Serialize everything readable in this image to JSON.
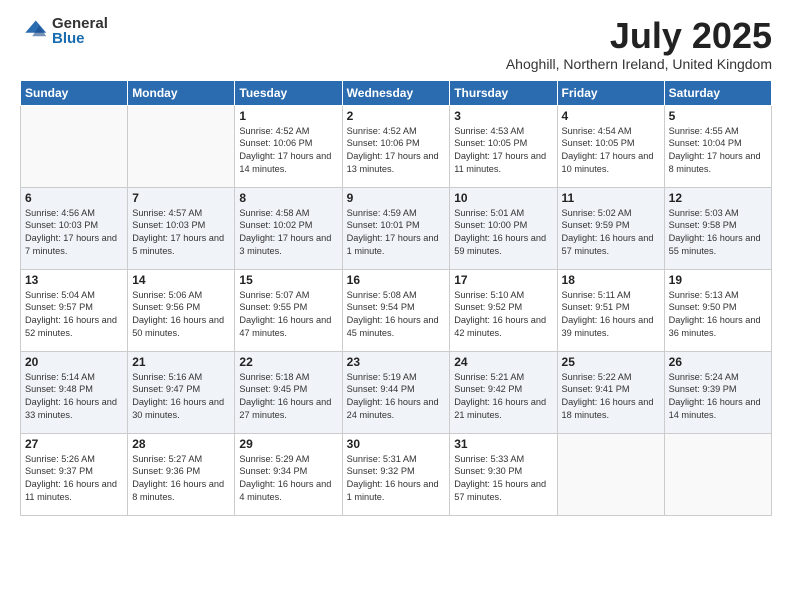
{
  "logo": {
    "general": "General",
    "blue": "Blue"
  },
  "title": {
    "month": "July 2025",
    "location": "Ahoghill, Northern Ireland, United Kingdom"
  },
  "weekdays": [
    "Sunday",
    "Monday",
    "Tuesday",
    "Wednesday",
    "Thursday",
    "Friday",
    "Saturday"
  ],
  "weeks": [
    [
      {
        "day": "",
        "sunrise": "",
        "sunset": "",
        "daylight": "",
        "empty": true
      },
      {
        "day": "",
        "sunrise": "",
        "sunset": "",
        "daylight": "",
        "empty": true
      },
      {
        "day": "1",
        "sunrise": "Sunrise: 4:52 AM",
        "sunset": "Sunset: 10:06 PM",
        "daylight": "Daylight: 17 hours and 14 minutes.",
        "empty": false
      },
      {
        "day": "2",
        "sunrise": "Sunrise: 4:52 AM",
        "sunset": "Sunset: 10:06 PM",
        "daylight": "Daylight: 17 hours and 13 minutes.",
        "empty": false
      },
      {
        "day": "3",
        "sunrise": "Sunrise: 4:53 AM",
        "sunset": "Sunset: 10:05 PM",
        "daylight": "Daylight: 17 hours and 11 minutes.",
        "empty": false
      },
      {
        "day": "4",
        "sunrise": "Sunrise: 4:54 AM",
        "sunset": "Sunset: 10:05 PM",
        "daylight": "Daylight: 17 hours and 10 minutes.",
        "empty": false
      },
      {
        "day": "5",
        "sunrise": "Sunrise: 4:55 AM",
        "sunset": "Sunset: 10:04 PM",
        "daylight": "Daylight: 17 hours and 8 minutes.",
        "empty": false
      }
    ],
    [
      {
        "day": "6",
        "sunrise": "Sunrise: 4:56 AM",
        "sunset": "Sunset: 10:03 PM",
        "daylight": "Daylight: 17 hours and 7 minutes.",
        "empty": false
      },
      {
        "day": "7",
        "sunrise": "Sunrise: 4:57 AM",
        "sunset": "Sunset: 10:03 PM",
        "daylight": "Daylight: 17 hours and 5 minutes.",
        "empty": false
      },
      {
        "day": "8",
        "sunrise": "Sunrise: 4:58 AM",
        "sunset": "Sunset: 10:02 PM",
        "daylight": "Daylight: 17 hours and 3 minutes.",
        "empty": false
      },
      {
        "day": "9",
        "sunrise": "Sunrise: 4:59 AM",
        "sunset": "Sunset: 10:01 PM",
        "daylight": "Daylight: 17 hours and 1 minute.",
        "empty": false
      },
      {
        "day": "10",
        "sunrise": "Sunrise: 5:01 AM",
        "sunset": "Sunset: 10:00 PM",
        "daylight": "Daylight: 16 hours and 59 minutes.",
        "empty": false
      },
      {
        "day": "11",
        "sunrise": "Sunrise: 5:02 AM",
        "sunset": "Sunset: 9:59 PM",
        "daylight": "Daylight: 16 hours and 57 minutes.",
        "empty": false
      },
      {
        "day": "12",
        "sunrise": "Sunrise: 5:03 AM",
        "sunset": "Sunset: 9:58 PM",
        "daylight": "Daylight: 16 hours and 55 minutes.",
        "empty": false
      }
    ],
    [
      {
        "day": "13",
        "sunrise": "Sunrise: 5:04 AM",
        "sunset": "Sunset: 9:57 PM",
        "daylight": "Daylight: 16 hours and 52 minutes.",
        "empty": false
      },
      {
        "day": "14",
        "sunrise": "Sunrise: 5:06 AM",
        "sunset": "Sunset: 9:56 PM",
        "daylight": "Daylight: 16 hours and 50 minutes.",
        "empty": false
      },
      {
        "day": "15",
        "sunrise": "Sunrise: 5:07 AM",
        "sunset": "Sunset: 9:55 PM",
        "daylight": "Daylight: 16 hours and 47 minutes.",
        "empty": false
      },
      {
        "day": "16",
        "sunrise": "Sunrise: 5:08 AM",
        "sunset": "Sunset: 9:54 PM",
        "daylight": "Daylight: 16 hours and 45 minutes.",
        "empty": false
      },
      {
        "day": "17",
        "sunrise": "Sunrise: 5:10 AM",
        "sunset": "Sunset: 9:52 PM",
        "daylight": "Daylight: 16 hours and 42 minutes.",
        "empty": false
      },
      {
        "day": "18",
        "sunrise": "Sunrise: 5:11 AM",
        "sunset": "Sunset: 9:51 PM",
        "daylight": "Daylight: 16 hours and 39 minutes.",
        "empty": false
      },
      {
        "day": "19",
        "sunrise": "Sunrise: 5:13 AM",
        "sunset": "Sunset: 9:50 PM",
        "daylight": "Daylight: 16 hours and 36 minutes.",
        "empty": false
      }
    ],
    [
      {
        "day": "20",
        "sunrise": "Sunrise: 5:14 AM",
        "sunset": "Sunset: 9:48 PM",
        "daylight": "Daylight: 16 hours and 33 minutes.",
        "empty": false
      },
      {
        "day": "21",
        "sunrise": "Sunrise: 5:16 AM",
        "sunset": "Sunset: 9:47 PM",
        "daylight": "Daylight: 16 hours and 30 minutes.",
        "empty": false
      },
      {
        "day": "22",
        "sunrise": "Sunrise: 5:18 AM",
        "sunset": "Sunset: 9:45 PM",
        "daylight": "Daylight: 16 hours and 27 minutes.",
        "empty": false
      },
      {
        "day": "23",
        "sunrise": "Sunrise: 5:19 AM",
        "sunset": "Sunset: 9:44 PM",
        "daylight": "Daylight: 16 hours and 24 minutes.",
        "empty": false
      },
      {
        "day": "24",
        "sunrise": "Sunrise: 5:21 AM",
        "sunset": "Sunset: 9:42 PM",
        "daylight": "Daylight: 16 hours and 21 minutes.",
        "empty": false
      },
      {
        "day": "25",
        "sunrise": "Sunrise: 5:22 AM",
        "sunset": "Sunset: 9:41 PM",
        "daylight": "Daylight: 16 hours and 18 minutes.",
        "empty": false
      },
      {
        "day": "26",
        "sunrise": "Sunrise: 5:24 AM",
        "sunset": "Sunset: 9:39 PM",
        "daylight": "Daylight: 16 hours and 14 minutes.",
        "empty": false
      }
    ],
    [
      {
        "day": "27",
        "sunrise": "Sunrise: 5:26 AM",
        "sunset": "Sunset: 9:37 PM",
        "daylight": "Daylight: 16 hours and 11 minutes.",
        "empty": false
      },
      {
        "day": "28",
        "sunrise": "Sunrise: 5:27 AM",
        "sunset": "Sunset: 9:36 PM",
        "daylight": "Daylight: 16 hours and 8 minutes.",
        "empty": false
      },
      {
        "day": "29",
        "sunrise": "Sunrise: 5:29 AM",
        "sunset": "Sunset: 9:34 PM",
        "daylight": "Daylight: 16 hours and 4 minutes.",
        "empty": false
      },
      {
        "day": "30",
        "sunrise": "Sunrise: 5:31 AM",
        "sunset": "Sunset: 9:32 PM",
        "daylight": "Daylight: 16 hours and 1 minute.",
        "empty": false
      },
      {
        "day": "31",
        "sunrise": "Sunrise: 5:33 AM",
        "sunset": "Sunset: 9:30 PM",
        "daylight": "Daylight: 15 hours and 57 minutes.",
        "empty": false
      },
      {
        "day": "",
        "sunrise": "",
        "sunset": "",
        "daylight": "",
        "empty": true
      },
      {
        "day": "",
        "sunrise": "",
        "sunset": "",
        "daylight": "",
        "empty": true
      }
    ]
  ]
}
